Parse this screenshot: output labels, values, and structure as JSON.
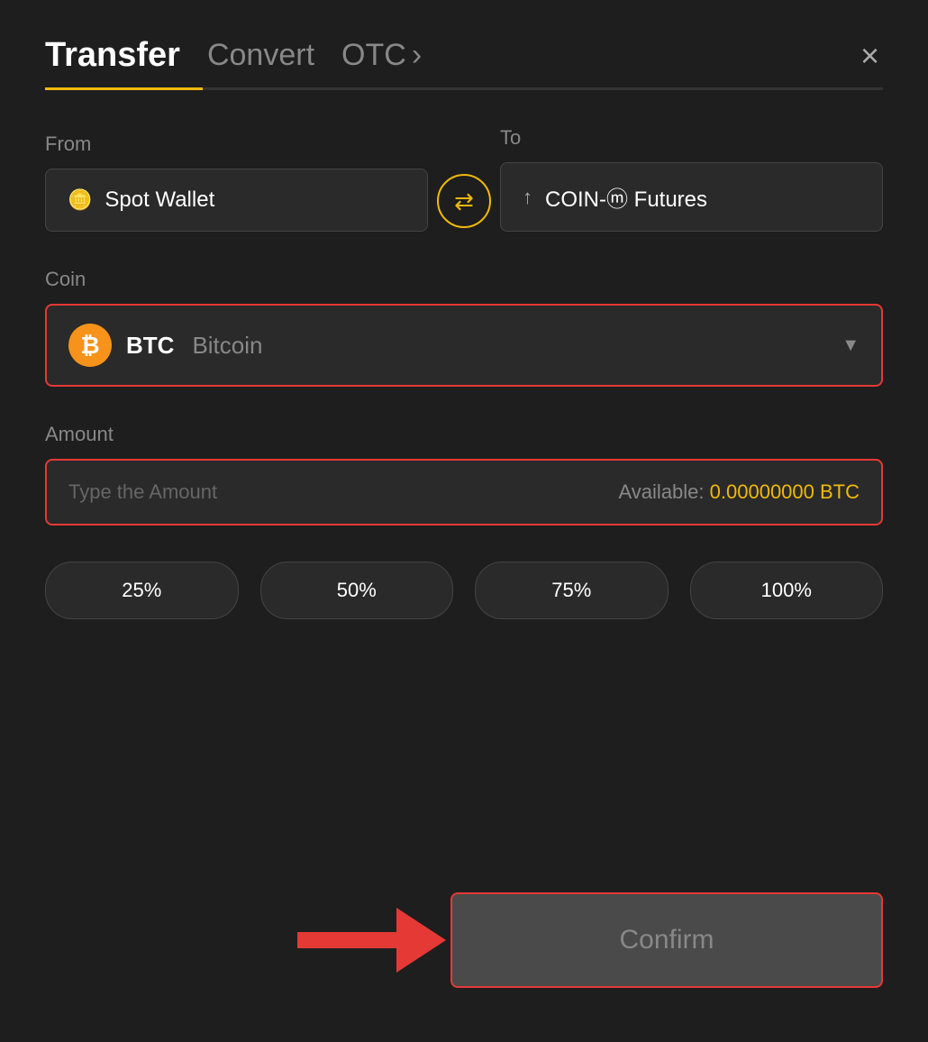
{
  "header": {
    "tab_transfer": "Transfer",
    "tab_convert": "Convert",
    "tab_otc": "OTC",
    "tab_otc_chevron": "›",
    "close_label": "×"
  },
  "from_field": {
    "label": "From",
    "wallet_icon": "▤",
    "wallet_name": "Spot Wallet"
  },
  "to_field": {
    "label": "To",
    "wallet_icon": "↑",
    "wallet_name": "COIN-ⓜ Futures"
  },
  "swap_icon": "⇄",
  "coin_field": {
    "label": "Coin",
    "symbol": "BTC",
    "full_name": "Bitcoin"
  },
  "amount_field": {
    "label": "Amount",
    "placeholder": "Type the Amount",
    "available_label": "Available:",
    "available_value": "0.00000000 BTC"
  },
  "percentage_buttons": [
    "25%",
    "50%",
    "75%",
    "100%"
  ],
  "confirm_button": "Confirm"
}
